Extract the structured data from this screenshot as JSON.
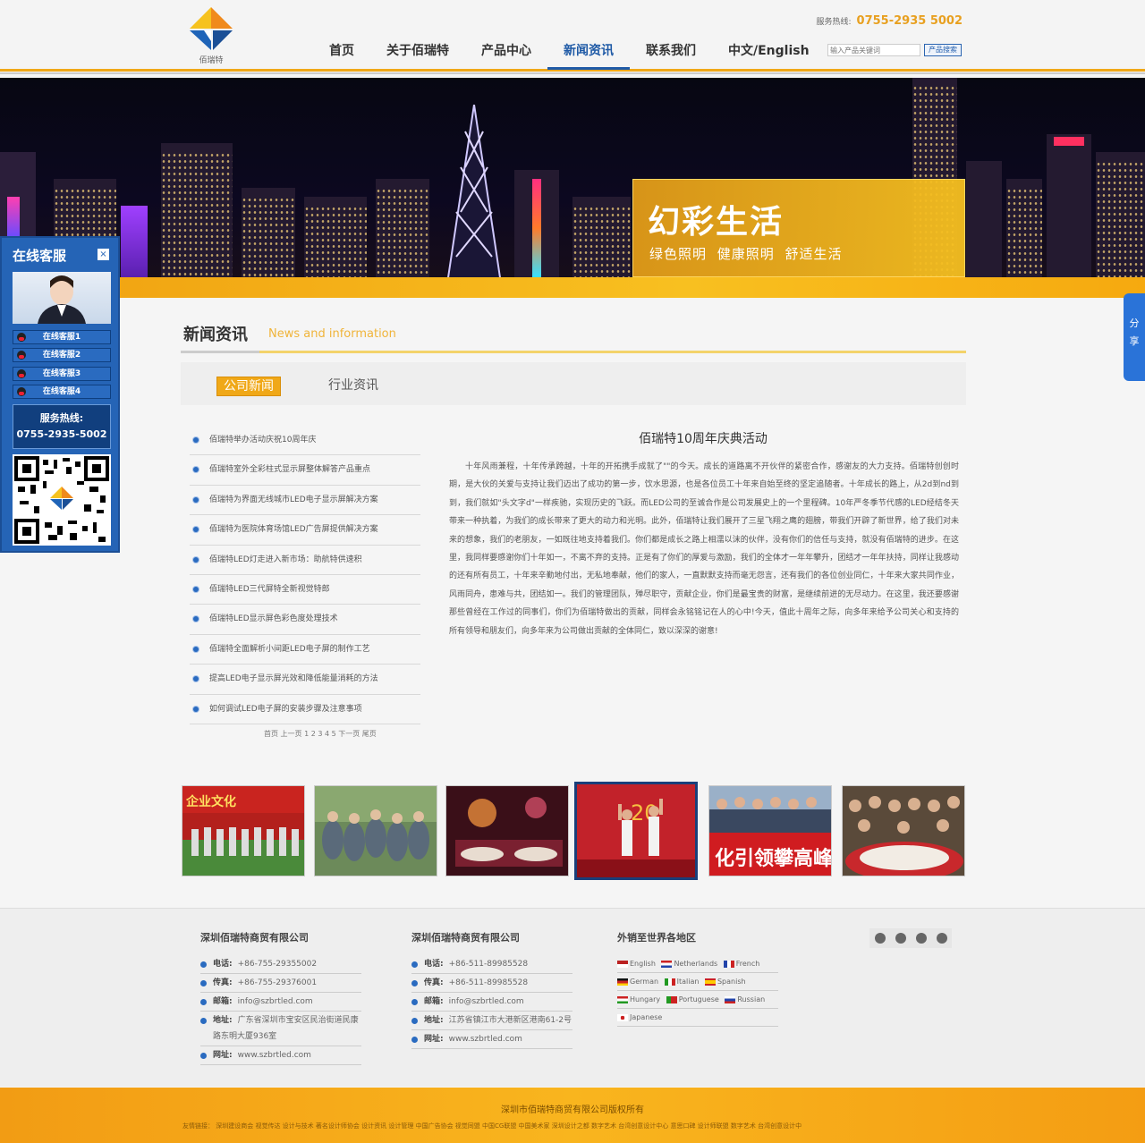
{
  "header": {
    "logo_text": "佰瑞特",
    "hotline_label": "服务热线:",
    "hotline": "0755-2935 5002",
    "nav": [
      {
        "label": "首页",
        "active": false
      },
      {
        "label": "关于佰瑞特",
        "active": false
      },
      {
        "label": "产品中心",
        "active": false
      },
      {
        "label": "新闻资讯",
        "active": true
      },
      {
        "label": "联系我们",
        "active": false
      },
      {
        "label": "中文/English",
        "active": false
      }
    ],
    "search_placeholder": "输入产品关键词",
    "search_button": "产品搜索"
  },
  "banner": {
    "title": "幻彩生活",
    "subtitle": "绿色照明 健康照明 舒适生活"
  },
  "service": {
    "title": "在线客服",
    "close": "×",
    "buttons": [
      "在线客服1",
      "在线客服2",
      "在线客服3",
      "在线客服4"
    ],
    "hotline_label": "服务热线:",
    "hotline": "0755-2935-5002"
  },
  "share": {
    "label": "分享"
  },
  "section": {
    "title": "新闻资讯",
    "subtitle": "News and information",
    "tabs": [
      "公司新闻",
      "行业资讯"
    ]
  },
  "news": [
    "佰瑞特举办活动庆祝10周年庆",
    "佰瑞特室外全彩柱式显示屏整体解答产品重点",
    "佰瑞特为界面无线城市LED电子显示屏解决方案",
    "佰瑞特为医院体育场馆LED广告屏提供解决方案",
    "佰瑞特LED灯走进入新市场：助航特供速积",
    "佰瑞特LED三代屏特全新视觉特郎",
    "佰瑞特LED显示屏色彩色度处理技术",
    "佰瑞特全面解析小间距LED电子屏的制作工艺",
    "提高LED电子显示屏光效和降低能量消耗的方法",
    "如何调试LED电子屏的安装步骤及注意事项"
  ],
  "pager": "首页 上一页 1 2 3 4 5 下一页 尾页",
  "article": {
    "title": "佰瑞特10周年庆典活动",
    "body": "十年风雨兼程，十年传承跨越，十年的开拓携手成就了\"\"的今天。成长的道路离不开伙伴的紧密合作，感谢友的大力支持。佰瑞特创创时期，是大伙的关爱与支持让我们迈出了成功的第一步，饮水思源，也是各位员工十年来自始至终的坚定追随者。十年成长的路上，从2d到nd到到，我们就如\"头文字d\"一样疾驰，实现历史的飞跃。而LED公司的至诚合作是公司发展史上的一个里程碑。10年严冬季节代感的LED经结冬天带来一种执着，为我们的成长带来了更大的动力和光明。此外，佰瑞特让我们展开了三星飞翔之鹰的翅膀，带我们开辟了新世界，给了我们对未来的想象，我们的老朋友，一如既往地支持着我们。你们都是成长之路上相濡以沫的伙伴，没有你们的信任与支持，就没有佰瑞特的进步。在这里，我同样要感谢你们十年如一，不离不弃的支持。正是有了你们的厚爱与激励，我们的全体才一年年攀升，团结才一年年扶持，同样让我感动的还有所有员工，十年来辛勤地付出，无私地奉献，他们的家人，一直默默支持而毫无怨言，还有我们的各位创业同仁，十年来大家共同作业，风雨同舟，患难与共，团结如一。我们的管理团队，殚尽职守，贡献企业，你们是最宝贵的财富，是继续前进的无尽动力。在这里，我还要感谢那些曾经在工作过的同事们，你们为佰瑞特做出的贡献，同样会永铭铭记在人的心中!今天，值此十周年之际，向多年来给予公司关心和支持的所有领导和朋友们，向多年来为公司做出贡献的全体同仁，致以深深的谢意!"
  },
  "footer": {
    "col1": {
      "title": "深圳佰瑞特商贸有限公司",
      "rows": [
        {
          "k": "电话:",
          "v": "+86-755-29355002"
        },
        {
          "k": "传真:",
          "v": "+86-755-29376001"
        },
        {
          "k": "邮箱:",
          "v": "info@szbrtled.com"
        },
        {
          "k": "地址:",
          "v": "广东省深圳市宝安区民治街道民康路东明大厦936室"
        },
        {
          "k": "网址:",
          "v": "www.szbrtled.com"
        }
      ]
    },
    "col2": {
      "title": "深圳佰瑞特商贸有限公司",
      "rows": [
        {
          "k": "电话:",
          "v": "+86-511-89985528"
        },
        {
          "k": "传真:",
          "v": "+86-511-89985528"
        },
        {
          "k": "邮箱:",
          "v": "info@szbrtled.com"
        },
        {
          "k": "地址:",
          "v": "江苏省镇江市大港新区港南61-2号"
        },
        {
          "k": "网址:",
          "v": "www.szbrtled.com"
        }
      ]
    },
    "col3": {
      "title": "外销至世界各地区",
      "languages": [
        "English",
        "Netherlands",
        "French",
        "German",
        "Italian",
        "Spanish",
        "Hungary",
        "Portuguese",
        "Russian",
        "Japanese"
      ]
    },
    "copyright": "深圳市佰瑞特商贸有限公司版权所有",
    "friend_links": "友情链接： 深圳建设商会  视觉传达  设计与技术  著名设计师协会  设计资讯  设计管理  中国广告协会  视觉同盟  中国CG联盟  中国美术家  深圳设计之都  数字艺术  台湾创意设计中心  意思口碑  设计师联盟  数字艺术  台湾创意设计中"
  }
}
